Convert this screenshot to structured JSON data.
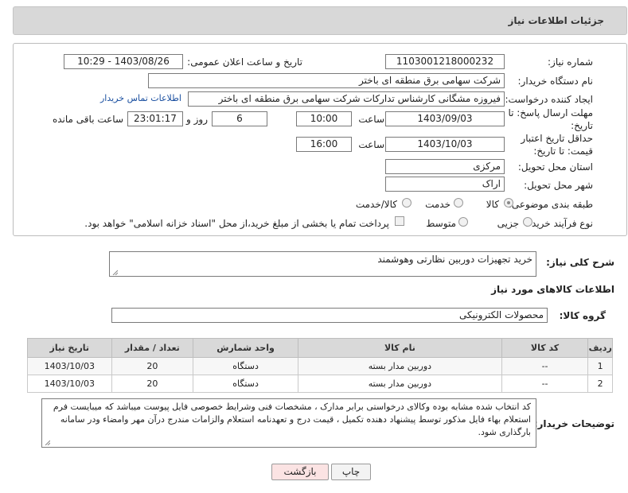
{
  "header": {
    "title": "جزئیات اطلاعات نیاز"
  },
  "form": {
    "need_number": {
      "label": "شماره نیاز:",
      "value": "1103001218000232"
    },
    "announce_datetime": {
      "label": "تاریخ و ساعت اعلان عمومی:",
      "value": "1403/08/26 - 10:29"
    },
    "buyer_org": {
      "label": "نام دستگاه خریدار:",
      "value": "شرکت سهامی برق منطقه ای باختر"
    },
    "requester": {
      "label": "ایجاد کننده درخواست:",
      "value": "فیروزه مشگانی کارشناس تدارکات شرکت سهامی برق منطقه ای باختر",
      "contact_link": "اطلاعات تماس خریدار"
    },
    "reply_deadline": {
      "label": "مهلت ارسال پاسخ: تا تاریخ:",
      "date": "1403/09/03",
      "time_label": "ساعت",
      "time": "10:00",
      "days": "6",
      "days_label": "روز و",
      "remaining": "23:01:17",
      "remaining_label": "ساعت باقی مانده"
    },
    "price_validity": {
      "label": "حداقل تاریخ اعتبار قیمت: تا تاریخ:",
      "date": "1403/10/03",
      "time_label": "ساعت",
      "time": "16:00"
    },
    "province": {
      "label": "استان محل تحویل:",
      "value": "مرکزی"
    },
    "city": {
      "label": "شهر محل تحویل:",
      "value": "اراک"
    },
    "category": {
      "label": "طبقه بندی موضوعی:",
      "options": [
        "کالا",
        "خدمت",
        "کالا/خدمت"
      ]
    },
    "purchase_process": {
      "label": "نوع فرآیند خرید :",
      "options": [
        "جزیی",
        "متوسط"
      ],
      "payment_note": "پرداخت تمام یا بخشی از مبلغ خرید،از محل \"اسناد خزانه اسلامی\" خواهد بود."
    }
  },
  "description": {
    "label": "شرح کلی نیاز:",
    "value": "خرید تجهیزات دوربین نظارتی وهوشمند"
  },
  "goods_section": {
    "title": "اطلاعات کالاهای مورد نیاز",
    "group_label": "گروه کالا:",
    "group_value": "محصولات الکترونیکی"
  },
  "table": {
    "headers": [
      "ردیف",
      "کد کالا",
      "نام کالا",
      "واحد شمارش",
      "تعداد / مقدار",
      "تاریخ نیاز"
    ],
    "rows": [
      [
        "1",
        "--",
        "دوربین مدار بسته",
        "دستگاه",
        "20",
        "1403/10/03"
      ],
      [
        "2",
        "--",
        "دوربین مدار بسته",
        "دستگاه",
        "20",
        "1403/10/03"
      ]
    ]
  },
  "buyer_notes": {
    "label": "توضیحات خریدار:",
    "value": "کد انتخاب شده مشابه بوده وکالای درخواستی برابر مدارک ، مشخصات فنی وشرایط خصوصی فایل پیوست میباشد که میبایست فرم استعلام بهاء فایل مذکور توسط پیشنهاد دهنده تکمیل ، قیمت درج و تعهدنامه استعلام والزامات مندرج درآن مهر وامضاء ودر سامانه بارگذاری شود."
  },
  "buttons": {
    "print": "چاپ",
    "back": "بازگشت"
  },
  "colors": {
    "header_bg": "#d8d8d8",
    "link": "#1a4fa0",
    "back_button_bg": "#fbe3e3"
  }
}
